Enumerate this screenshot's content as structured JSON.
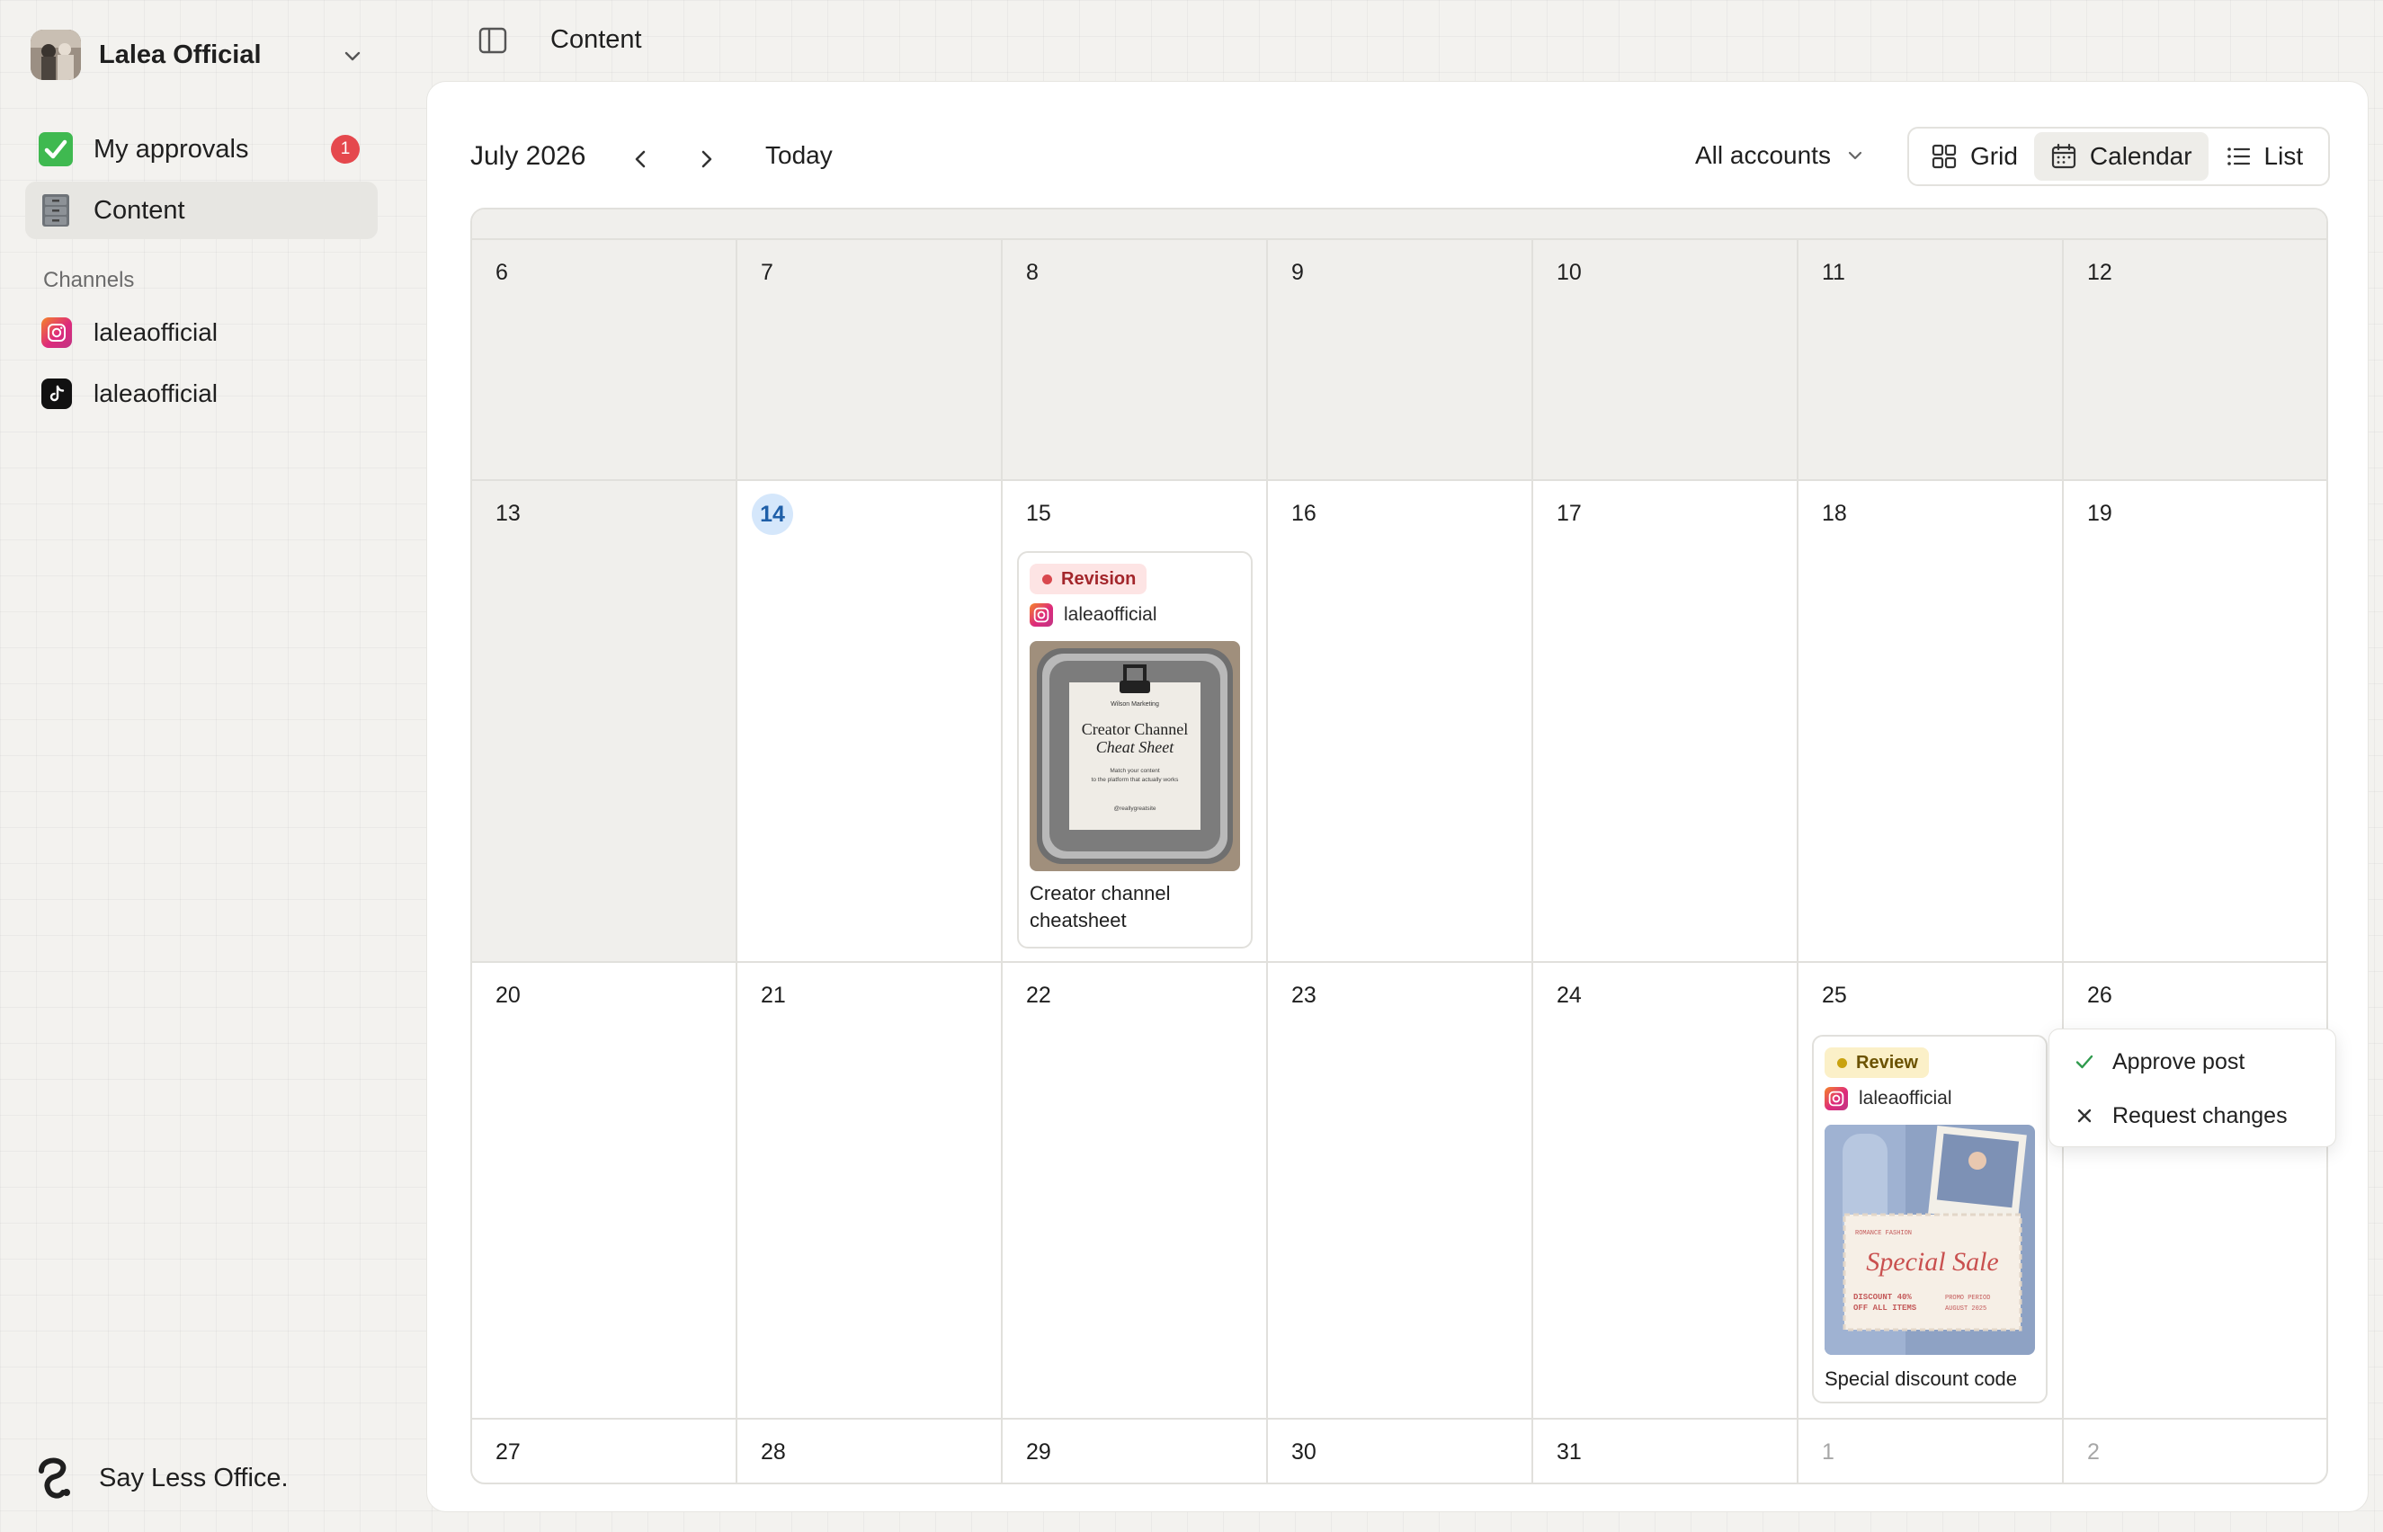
{
  "sidebar": {
    "workspace_name": "Lalea Official",
    "nav": [
      {
        "label": "My approvals",
        "badge": "1",
        "icon": "check-mark-icon"
      },
      {
        "label": "Content",
        "icon": "file-cabinet-icon"
      }
    ],
    "channels_title": "Channels",
    "channels": [
      {
        "label": "laleaofficial",
        "icon": "instagram-icon"
      },
      {
        "label": "laleaofficial",
        "icon": "tiktok-icon"
      }
    ],
    "brand": "Say Less Office."
  },
  "topbar": {
    "title": "Content"
  },
  "toolbar": {
    "month": "July 2026",
    "today": "Today",
    "accounts": "All accounts",
    "views": [
      "Grid",
      "Calendar",
      "List"
    ],
    "active_view": "Calendar"
  },
  "calendar": {
    "today": "14",
    "weeks": [
      [
        "6",
        "7",
        "8",
        "9",
        "10",
        "11",
        "12"
      ],
      [
        "13",
        "14",
        "15",
        "16",
        "17",
        "18",
        "19"
      ],
      [
        "20",
        "21",
        "22",
        "23",
        "24",
        "25",
        "26"
      ],
      [
        "27",
        "28",
        "29",
        "30",
        "31",
        "1",
        "2"
      ]
    ]
  },
  "posts": [
    {
      "date": "15",
      "status": "Revision",
      "account": "laleaofficial",
      "title": "Creator channel cheatsheet",
      "image_text": [
        "Wilson Marketing",
        "Creator Channel",
        "Cheat Sheet",
        "Match your content",
        "to the platform that actually works",
        "@reallygreatsite"
      ]
    },
    {
      "date": "25",
      "status": "Review",
      "account": "laleaofficial",
      "title": "Special discount code",
      "image_text": [
        "ROMANCE FASHION",
        "Special Sale",
        "DISCOUNT 40%",
        "OFF ALL ITEMS",
        "PROMO PERIOD",
        "AUGUST 2025"
      ]
    }
  ],
  "popover": {
    "approve": "Approve post",
    "request": "Request changes"
  },
  "colors": {
    "badge": "#e5484d",
    "today_bg": "#d5e7fb",
    "revision": "#d9484e",
    "review": "#c9a20f",
    "approve_check": "#2f9a4d"
  }
}
